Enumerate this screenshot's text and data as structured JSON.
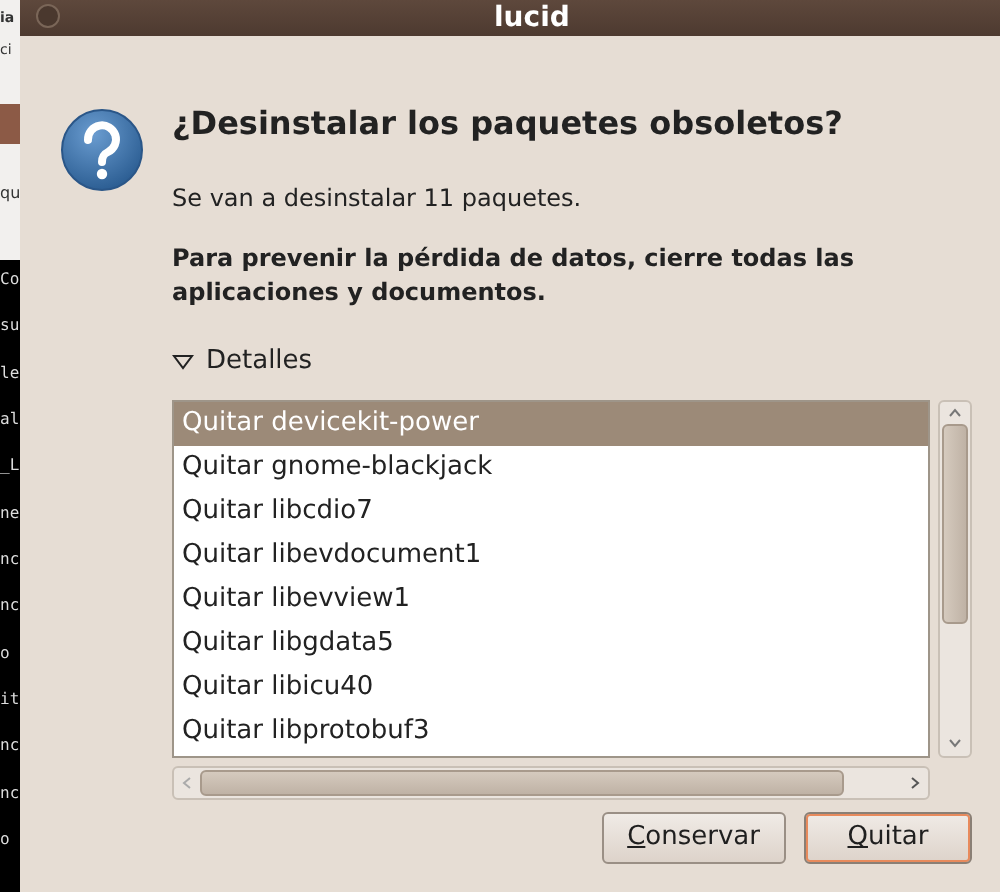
{
  "background_window": {
    "top_fragments": [
      "ia",
      "ci"
    ],
    "mid_fragment": "qu",
    "terminal_lines": [
      "Co",
      "su",
      "le",
      "al",
      "_L",
      "ne",
      "nc",
      "nc",
      "o",
      "it",
      "nc",
      "nc",
      "o"
    ]
  },
  "window": {
    "title": "lucid"
  },
  "dialog": {
    "heading": "¿Desinstalar los paquetes obsoletos?",
    "message": "Se van a desinstalar 11 paquetes.",
    "warning": "Para prevenir la pérdida de datos, cierre todas las aplicaciones y documentos.",
    "details": {
      "label": "Detalles",
      "expanded": true
    },
    "packages": [
      {
        "label": "Quitar devicekit-power",
        "selected": true
      },
      {
        "label": "Quitar gnome-blackjack",
        "selected": false
      },
      {
        "label": "Quitar libcdio7",
        "selected": false
      },
      {
        "label": "Quitar libevdocument1",
        "selected": false
      },
      {
        "label": "Quitar libevview1",
        "selected": false
      },
      {
        "label": "Quitar libgdata5",
        "selected": false
      },
      {
        "label": "Quitar libicu40",
        "selected": false
      },
      {
        "label": "Quitar libprotobuf3",
        "selected": false
      }
    ],
    "buttons": [
      {
        "label": "Conservar",
        "default": false
      },
      {
        "label": "Quitar",
        "default": true
      }
    ]
  }
}
